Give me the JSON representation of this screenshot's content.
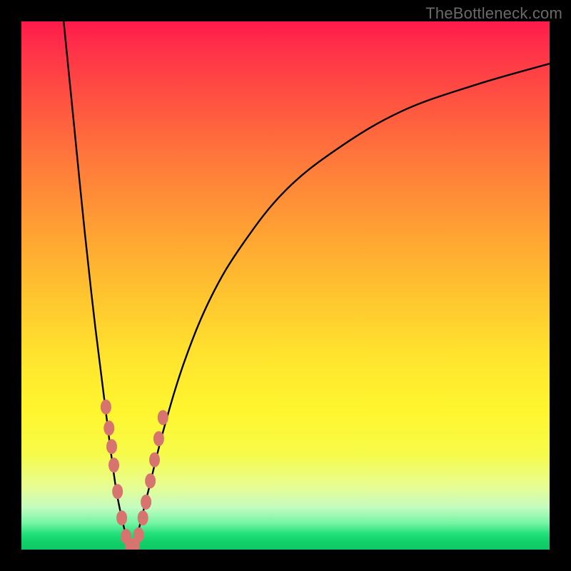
{
  "watermark": "TheBottleneck.com",
  "colors": {
    "frame": "#000000",
    "curve": "#000000",
    "dot": "#d8746f",
    "gradient_top": "#ff1a4b",
    "gradient_bottom": "#0fc863"
  },
  "chart_data": {
    "type": "line",
    "title": "",
    "xlabel": "",
    "ylabel": "",
    "xlim": [
      0,
      100
    ],
    "ylim": [
      0,
      100
    ],
    "notes": "No axis ticks or numeric labels are rendered; values are visual estimates on a 0–100 normalized scale. y≈100 at top, y≈0 at bottom (green). Two black curves form a V with minimum near x≈20, y≈0. Pink dots cluster along both branches near the valley (roughly y in 0–30).",
    "series": [
      {
        "name": "left-branch",
        "x": [
          8,
          10,
          12,
          14,
          16,
          17,
          18,
          19,
          20,
          21
        ],
        "y": [
          100,
          80,
          60,
          42,
          26,
          18,
          11,
          6,
          2,
          0
        ]
      },
      {
        "name": "right-branch",
        "x": [
          21,
          22,
          24,
          27,
          31,
          36,
          42,
          50,
          60,
          72,
          86,
          100
        ],
        "y": [
          0,
          3,
          11,
          23,
          36,
          48,
          58,
          68,
          76,
          83,
          88,
          92
        ]
      }
    ],
    "points": {
      "name": "highlighted-dots",
      "x": [
        16.0,
        16.6,
        17.1,
        17.5,
        18.2,
        19.0,
        19.8,
        20.6,
        21.4,
        22.2,
        23.0,
        23.6,
        24.4,
        25.2,
        26.0,
        26.8
      ],
      "y": [
        27.0,
        23.0,
        19.5,
        16.0,
        11.0,
        6.0,
        2.5,
        0.8,
        0.8,
        2.8,
        6.0,
        9.0,
        13.0,
        17.0,
        21.0,
        25.0
      ]
    }
  }
}
